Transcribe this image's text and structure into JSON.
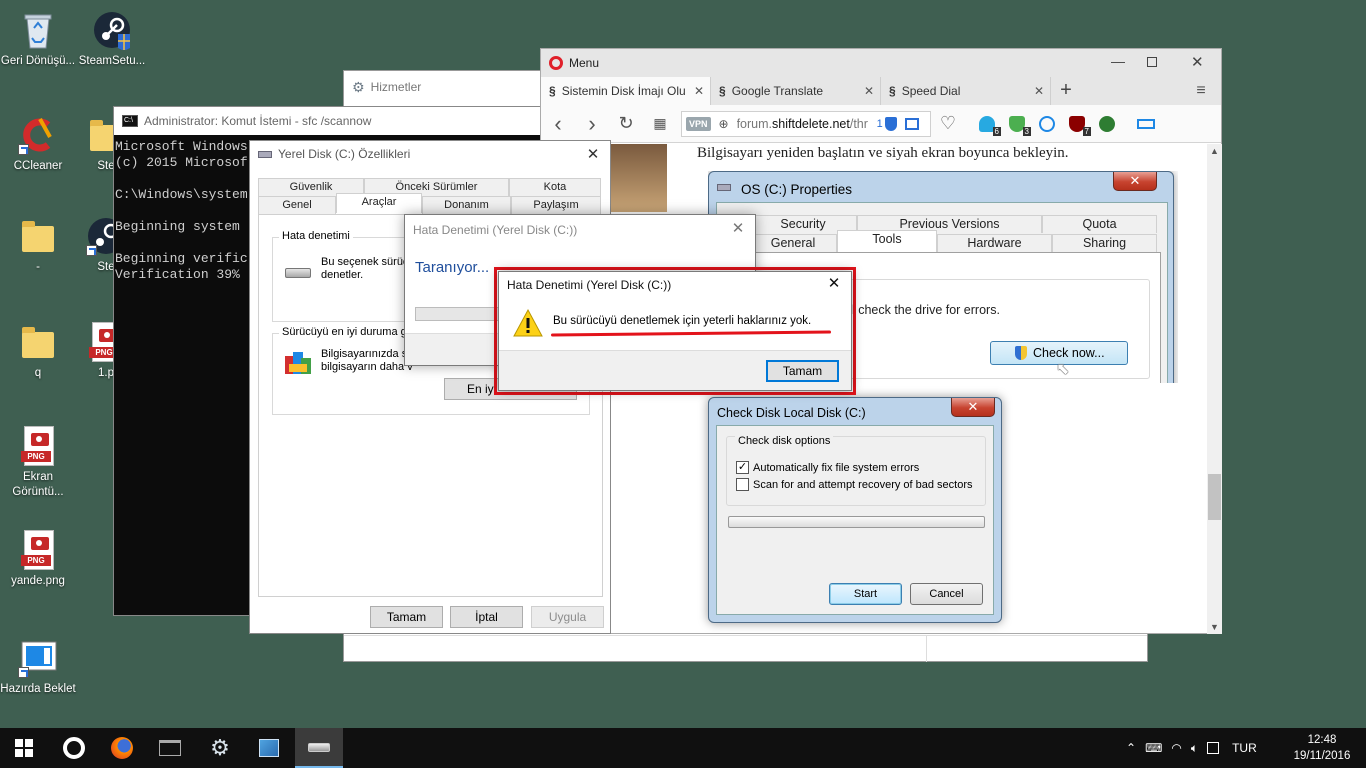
{
  "desktop": {
    "icons": [
      {
        "label": "Geri Dönüşü..."
      },
      {
        "label": "SteamSetu..."
      },
      {
        "label": "CCleaner"
      },
      {
        "label": "Ste"
      },
      {
        "label": "-"
      },
      {
        "label": "Ste"
      },
      {
        "label": "q"
      },
      {
        "label": "1.p"
      },
      {
        "label": "Ekran Görüntü..."
      },
      {
        "label": "yande.png"
      },
      {
        "label": "Hazırda Beklet"
      }
    ],
    "png_tag": "PNG"
  },
  "cmd": {
    "title": "Administrator: Komut İstemi - sfc  /scannow",
    "lines": [
      "Microsoft Windows",
      "(c) 2015 Microsof",
      "",
      "C:\\Windows\\system",
      "",
      "Beginning system",
      "",
      "Beginning verific",
      "Verification 39%"
    ]
  },
  "services": {
    "title": "Hizmetler"
  },
  "opera": {
    "menu_label": "Menu",
    "tabs": [
      {
        "label": "Sistemin Disk İmajı Olu"
      },
      {
        "label": "Google Translate"
      },
      {
        "label": "Speed Dial"
      }
    ],
    "vpn": "VPN",
    "url_prefix": "forum.",
    "url_domain": "shiftdelete.net",
    "url_suffix": "/thr",
    "url_badge": "1",
    "ext_badges": [
      "6",
      "3",
      "7"
    ],
    "page_text": "Bilgisayarı yeniden başlatın ve siyah ekran boyunca bekleyin."
  },
  "os_props": {
    "title": "OS (C:) Properties",
    "tabs_top": [
      "Security",
      "Previous Versions",
      "Quota"
    ],
    "tabs_bottom": [
      "General",
      "Tools",
      "Hardware",
      "Sharing"
    ],
    "partial_text": "on will check the drive for errors.",
    "check_now": "Check now..."
  },
  "check_disk": {
    "title": "Check Disk Local Disk (C:)",
    "group_label": "Check disk options",
    "opt_fix": "Automatically fix file system errors",
    "opt_fix_checked": true,
    "opt_scan": "Scan for and attempt recovery of bad sectors",
    "opt_scan_checked": false,
    "start": "Start",
    "cancel": "Cancel"
  },
  "tr_props": {
    "title": "Yerel Disk (C:) Özellikleri",
    "tabs_top": [
      "Güvenlik",
      "Önceki Sürümler",
      "Kota"
    ],
    "tabs_bottom": [
      "Genel",
      "Araçlar",
      "Donanım",
      "Paylaşım"
    ],
    "group1_label": "Hata denetimi",
    "group1_text_1": "Bu seçenek sürüc",
    "group1_text_2": "denetler.",
    "group2_label": "Sürücüyü en iyi duruma ge",
    "group2_text_1": "Bilgisayarınızda sü",
    "group2_text_2": "bilgisayarın daha v",
    "optimize_btn": "En iyi",
    "ok": "Tamam",
    "cancel": "İptal",
    "apply": "Uygula"
  },
  "scan_dialog": {
    "title": "Hata Denetimi (Yerel Disk (C:))",
    "status": "Taranıyor..."
  },
  "error_dialog": {
    "title": "Hata Denetimi (Yerel Disk (C:))",
    "message": "Bu sürücüyü denetlemek için yeterli haklarınız yok.",
    "ok": "Tamam",
    "highlight_color": "#e3131b"
  },
  "taskbar": {
    "lang": "TUR",
    "time": "12:48",
    "date": "19/11/2016"
  }
}
